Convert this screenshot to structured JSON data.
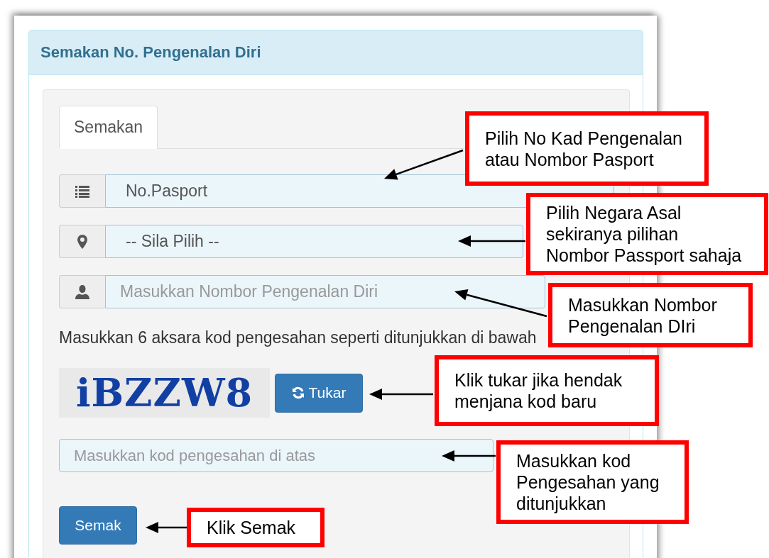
{
  "panel": {
    "title": "Semakan No. Pengenalan Diri"
  },
  "tabs": [
    {
      "label": "Semakan",
      "selected": true
    }
  ],
  "fields": [
    {
      "kind": "select",
      "value": "No.Pasport"
    },
    {
      "kind": "select",
      "value": "-- Sila Pilih --"
    },
    {
      "kind": "input",
      "placeholder": "Masukkan Nombor Pengenalan Diri"
    }
  ],
  "helper_text": "Masukkan 6 aksara kod pengesahan seperti ditunjukkan di bawah",
  "captcha": {
    "code": "iBZZW8",
    "refresh_button": "Tukar"
  },
  "code_field": {
    "placeholder": "Masukkan kod pengesahan di atas"
  },
  "submit_button": "Semak",
  "callouts": [
    {
      "lines": [
        "Pilih No Kad Pengenalan",
        "atau Nombor Pasport"
      ]
    },
    {
      "lines": [
        "Pilih Negara Asal",
        "sekiranya pilihan",
        "Nombor Passport sahaja"
      ]
    },
    {
      "lines": [
        "Masukkan Nombor",
        "Pengenalan DIri"
      ]
    },
    {
      "lines": [
        "Klik tukar jika hendak",
        "menjana kod baru"
      ]
    },
    {
      "lines": [
        "Masukkan kod",
        "Pengesahan yang",
        "ditunjukkan"
      ]
    },
    {
      "lines": [
        "Klik Semak"
      ]
    }
  ]
}
